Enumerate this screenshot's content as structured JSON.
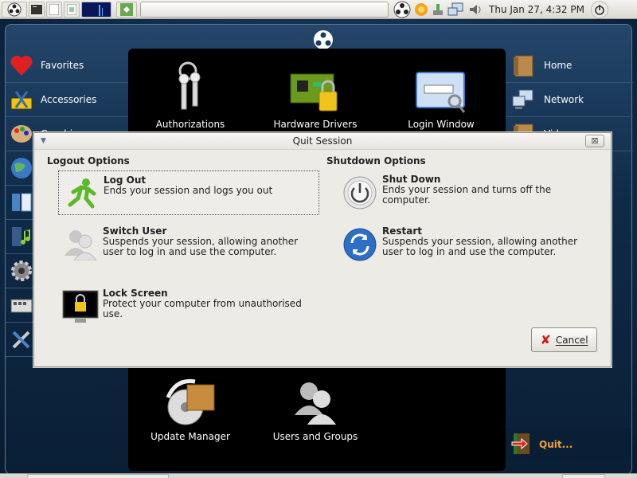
{
  "panel": {
    "clock": "Thu Jan 27,  4:32 PM",
    "icons": [
      "foot-logo-icon",
      "terminal-icon",
      "file-manager-icon",
      "system-monitor-icon",
      "app-launcher-icon",
      "network-icon",
      "volume-icon",
      "shutdown-icon"
    ]
  },
  "menu": {
    "categories": [
      {
        "label": "Favorites",
        "icon": "heart-icon"
      },
      {
        "label": "Accessories",
        "icon": "accessories-icon"
      },
      {
        "label": "Graphics",
        "icon": "palette-icon"
      },
      {
        "label": "",
        "icon": "globe-icon"
      },
      {
        "label": "",
        "icon": "office-icon"
      },
      {
        "label": "",
        "icon": "multimedia-icon"
      },
      {
        "label": "",
        "icon": "system-gear-icon"
      },
      {
        "label": "",
        "icon": "keyboard-icon"
      },
      {
        "label": "",
        "icon": "tools-icon"
      }
    ],
    "apps": [
      {
        "label": "Authorizations",
        "icon": "keys-icon"
      },
      {
        "label": "Hardware Drivers",
        "icon": "circuit-lock-icon"
      },
      {
        "label": "Login Window",
        "icon": "login-window-icon"
      },
      {
        "label": "Update Manager",
        "icon": "update-manager-icon"
      },
      {
        "label": "Users and Groups",
        "icon": "users-groups-icon"
      }
    ],
    "places": [
      {
        "label": "Home",
        "icon": "home-folder-icon"
      },
      {
        "label": "Network",
        "icon": "network-places-icon"
      },
      {
        "label": "Videos",
        "icon": "videos-folder-icon"
      }
    ],
    "quit_label": "Quit..."
  },
  "dialog": {
    "title": "Quit Session",
    "logout_header": "Logout Options",
    "shutdown_header": "Shutdown Options",
    "options": {
      "logout": {
        "title": "Log Out",
        "desc": "Ends your session and logs you out"
      },
      "switch_user": {
        "title": "Switch User",
        "desc": "Suspends your session, allowing another user to log in and use the computer."
      },
      "lock_screen": {
        "title": "Lock Screen",
        "desc": "Protect your computer from unauthorised use."
      },
      "shut_down": {
        "title": "Shut Down",
        "desc": "Ends your session and turns off the computer."
      },
      "restart": {
        "title": "Restart",
        "desc": "Suspends your session, allowing another user to log in and use the computer."
      }
    },
    "cancel_label": "Cancel",
    "close_glyph": "⊠"
  }
}
